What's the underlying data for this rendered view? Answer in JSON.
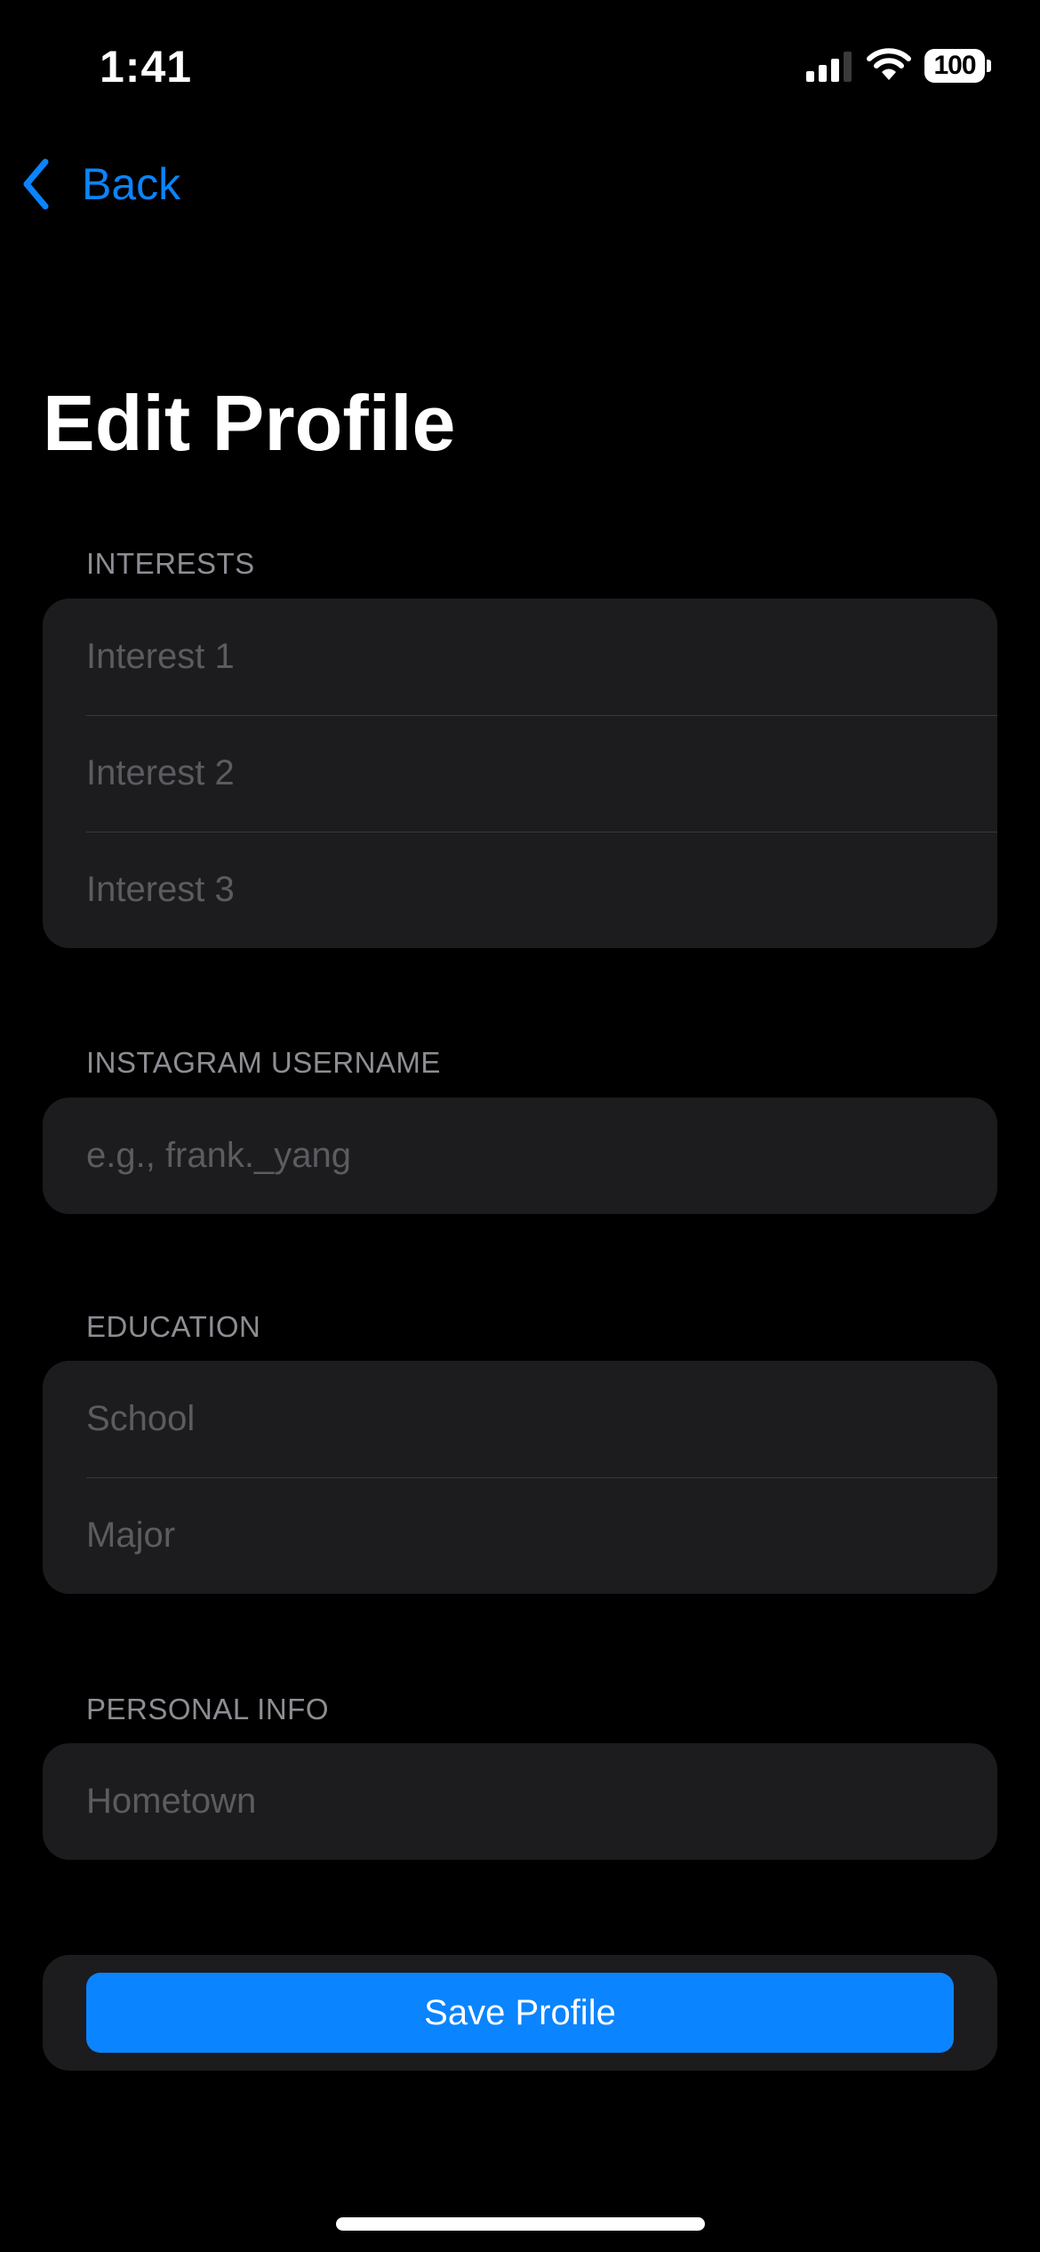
{
  "status_bar": {
    "time": "1:41",
    "battery": "100"
  },
  "nav": {
    "back_label": "Back"
  },
  "page_title": "Edit Profile",
  "sections": {
    "interests": {
      "label": "INTERESTS",
      "placeholders": [
        "Interest 1",
        "Interest 2",
        "Interest 3"
      ]
    },
    "instagram": {
      "label": "INSTAGRAM USERNAME",
      "placeholder": "e.g., frank._yang"
    },
    "education": {
      "label": "EDUCATION",
      "school_placeholder": "School",
      "major_placeholder": "Major"
    },
    "personal": {
      "label": "PERSONAL INFO",
      "hometown_placeholder": "Hometown"
    }
  },
  "save_label": "Save Profile",
  "colors": {
    "accent": "#0a84ff",
    "card": "#1c1c1e",
    "background": "#000000"
  }
}
